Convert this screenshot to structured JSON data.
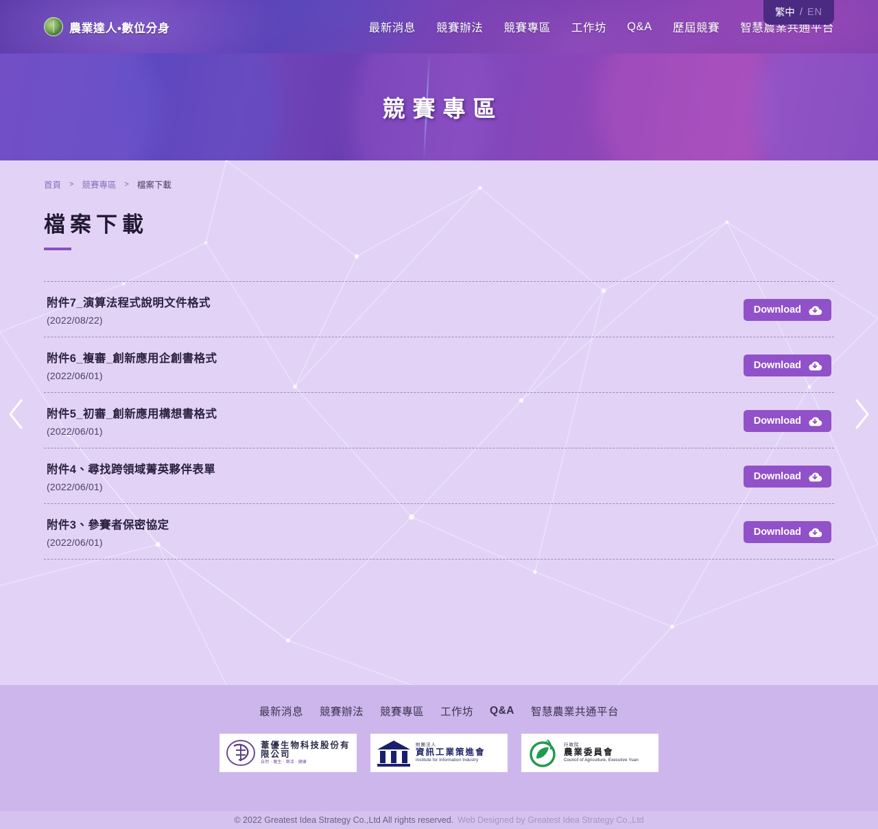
{
  "header": {
    "brand": {
      "emblem_icon": "agriculture-emblem-icon",
      "text": "農業達人•數位分身"
    },
    "nav": [
      {
        "label": "最新消息"
      },
      {
        "label": "競賽辦法"
      },
      {
        "label": "競賽專區"
      },
      {
        "label": "工作坊"
      },
      {
        "label": "Q&A"
      },
      {
        "label": "歷屆競賽"
      },
      {
        "label": "智慧農業共通平台"
      }
    ],
    "language": {
      "active": "繁中",
      "separator": "/",
      "inactive": "EN"
    }
  },
  "hero": {
    "title": "競賽專區"
  },
  "breadcrumb": {
    "home": "首頁",
    "separator": "＞",
    "section": "競賽專區",
    "current": "檔案下載"
  },
  "page": {
    "title": "檔案下載"
  },
  "files": [
    {
      "name": "附件7_演算法程式說明文件格式",
      "date": "(2022/08/22)",
      "download_label": "Download"
    },
    {
      "name": "附件6_複審_創新應用企創書格式",
      "date": "(2022/06/01)",
      "download_label": "Download"
    },
    {
      "name": "附件5_初審_創新應用構想書格式",
      "date": "(2022/06/01)",
      "download_label": "Download"
    },
    {
      "name": "附件4、尋找跨領域菁英夥伴表單",
      "date": "(2022/06/01)",
      "download_label": "Download"
    },
    {
      "name": "附件3、參賽者保密協定",
      "date": "(2022/06/01)",
      "download_label": "Download"
    }
  ],
  "carousel": {
    "prev_icon": "chevron-left-icon",
    "next_icon": "chevron-right-icon"
  },
  "footer": {
    "nav": [
      {
        "label": "最新消息",
        "bold": false
      },
      {
        "label": "競賽辦法",
        "bold": false
      },
      {
        "label": "競賽專區",
        "bold": false
      },
      {
        "label": "工作坊",
        "bold": false
      },
      {
        "label": "Q&A",
        "bold": true
      },
      {
        "label": "智慧農業共通平台",
        "bold": false
      }
    ],
    "logos": [
      {
        "mark": "wei-you-seal-icon",
        "sup": "",
        "main": "葦優生物科技股份有限公司",
        "sub": "自然 ‧ 養生 ‧ 樂活 ‧ 健康"
      },
      {
        "mark": "iii-temple-icon",
        "sup": "財團法人",
        "main": "資訊工業策進會",
        "sub": "Institute for Information Industry"
      },
      {
        "mark": "coa-leaf-icon",
        "sup": "行政院",
        "main": "農業委員會",
        "sub": "Council of Agriculture, Executive Yuan"
      }
    ],
    "copyright_primary": "© 2022 Greatest Idea Strategy Co.,Ltd All rights reserved.",
    "copyright_secondary": "Web Designed by Greatest Idea Strategy Co.,Ltd"
  },
  "colors": {
    "brand_purple": "#9151c9",
    "header_purple": "#6b3fb4",
    "page_bg": "#e2d3f6",
    "footer_bg": "#cdb6ec",
    "copyright_bg": "#d6c2ef"
  }
}
